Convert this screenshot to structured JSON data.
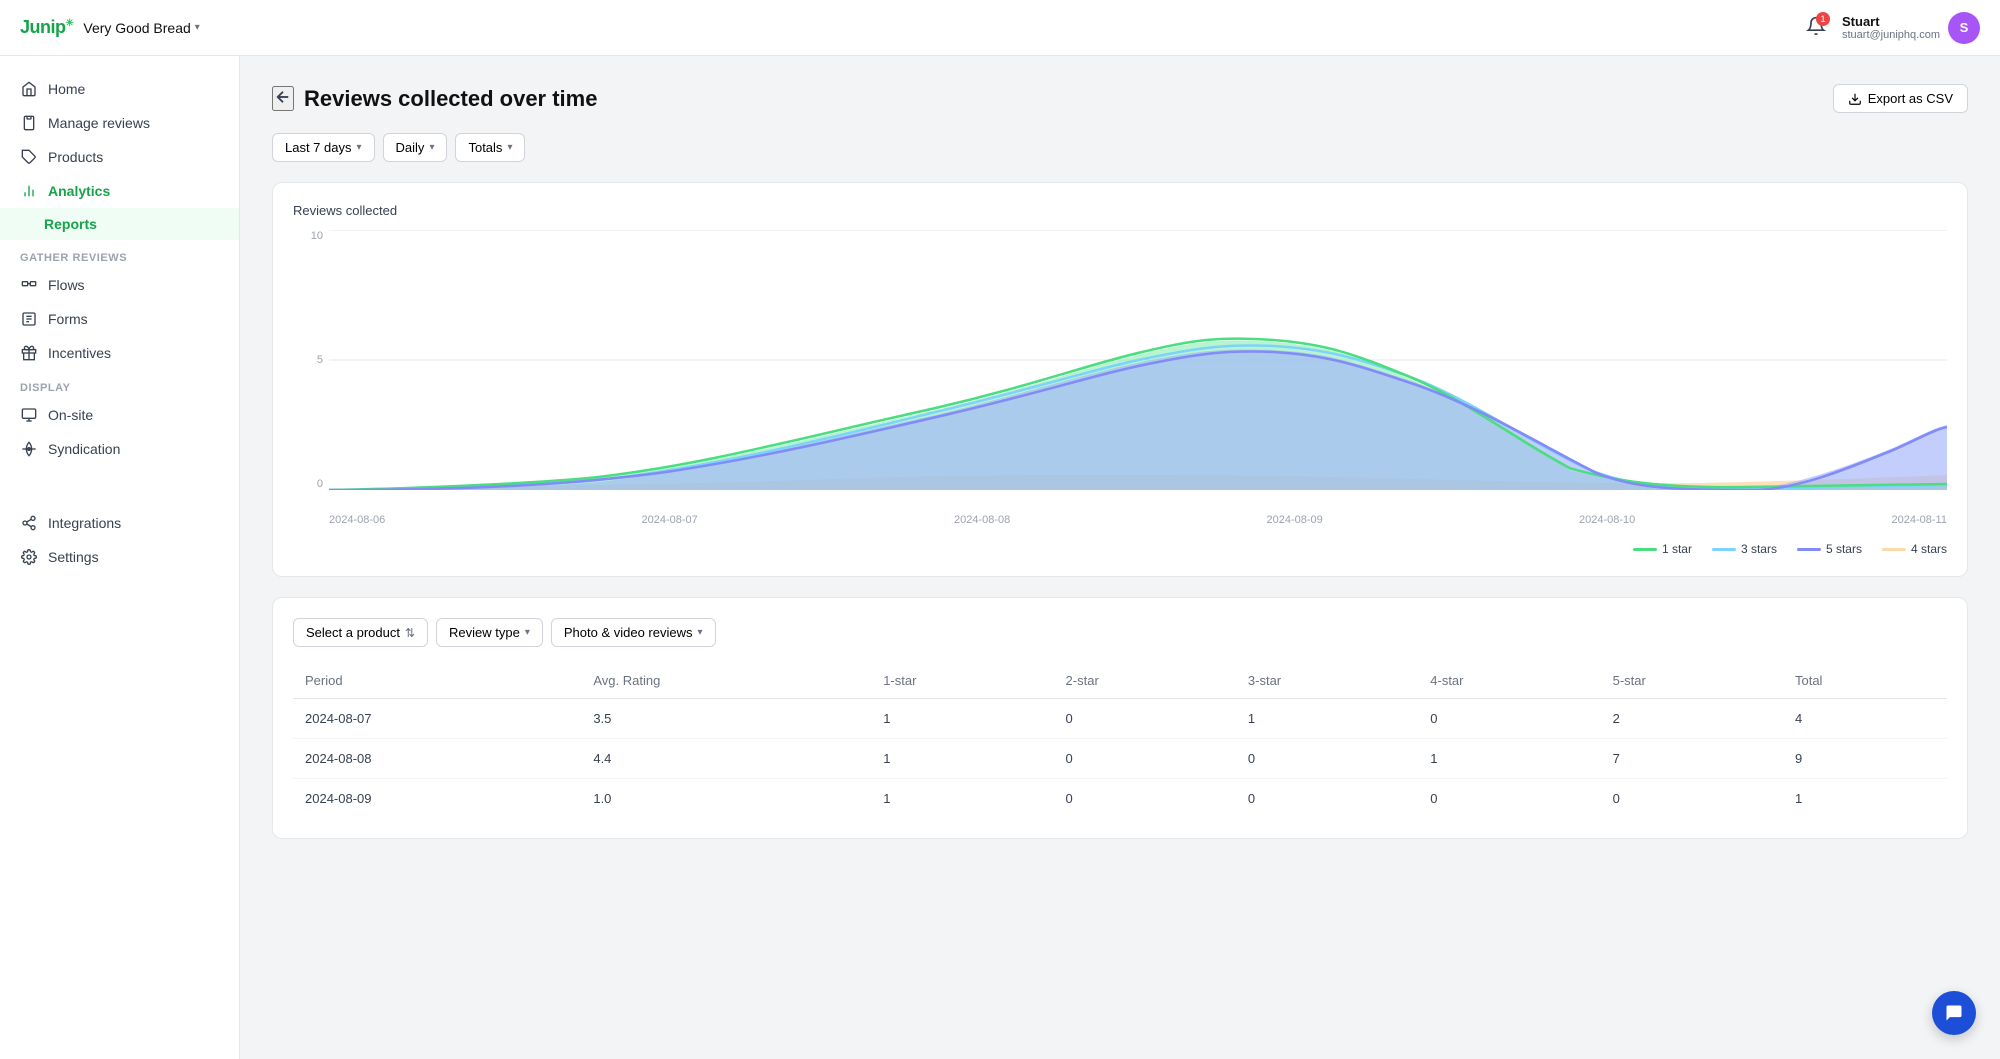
{
  "app": {
    "logo": "Junip",
    "brand": "Very Good Bread",
    "brand_dropdown_icon": "chevron-down"
  },
  "topnav": {
    "notification_count": "1",
    "user_name": "Stuart",
    "user_email": "stuart@juniphq.com",
    "user_initial": "S"
  },
  "sidebar": {
    "main_items": [
      {
        "id": "home",
        "label": "Home",
        "icon": "home"
      },
      {
        "id": "manage-reviews",
        "label": "Manage reviews",
        "icon": "clipboard"
      },
      {
        "id": "products",
        "label": "Products",
        "icon": "tag"
      },
      {
        "id": "analytics",
        "label": "Analytics",
        "icon": "bar-chart",
        "active": false
      },
      {
        "id": "reports",
        "label": "Reports",
        "icon": "sub",
        "active": true
      }
    ],
    "gather_section": "Gather reviews",
    "gather_items": [
      {
        "id": "flows",
        "label": "Flows",
        "icon": "flow"
      },
      {
        "id": "forms",
        "label": "Forms",
        "icon": "form"
      },
      {
        "id": "incentives",
        "label": "Incentives",
        "icon": "gift"
      }
    ],
    "display_section": "Display",
    "display_items": [
      {
        "id": "on-site",
        "label": "On-site",
        "icon": "monitor"
      },
      {
        "id": "syndication",
        "label": "Syndication",
        "icon": "syndication"
      }
    ],
    "bottom_items": [
      {
        "id": "integrations",
        "label": "Integrations",
        "icon": "integrations"
      },
      {
        "id": "settings",
        "label": "Settings",
        "icon": "settings"
      }
    ]
  },
  "page": {
    "back_label": "←",
    "title": "Reviews collected over time",
    "export_label": "Export as CSV"
  },
  "filters": [
    {
      "id": "date-range",
      "label": "Last 7 days"
    },
    {
      "id": "frequency",
      "label": "Daily"
    },
    {
      "id": "totals",
      "label": "Totals"
    }
  ],
  "chart": {
    "title": "Reviews collected",
    "y_labels": [
      "10",
      "5",
      "0"
    ],
    "x_labels": [
      "2024-08-06",
      "2024-08-07",
      "2024-08-08",
      "2024-08-09",
      "2024-08-10",
      "2024-08-11"
    ],
    "legend": [
      {
        "id": "1star",
        "label": "1 star",
        "color": "#4ade80"
      },
      {
        "id": "3stars",
        "label": "3 stars",
        "color": "#7dd3fc"
      },
      {
        "id": "5stars",
        "label": "5 stars",
        "color": "#818cf8"
      },
      {
        "id": "4stars",
        "label": "4 stars",
        "color": "#fcd9a8"
      }
    ]
  },
  "table_filters": [
    {
      "id": "product",
      "label": "Select a product",
      "type": "selector"
    },
    {
      "id": "review-type",
      "label": "Review type"
    },
    {
      "id": "media-type",
      "label": "Photo & video reviews"
    }
  ],
  "table": {
    "headers": [
      "Period",
      "Avg. Rating",
      "1-star",
      "2-star",
      "3-star",
      "4-star",
      "5-star",
      "Total"
    ],
    "rows": [
      {
        "period": "2024-08-07",
        "avg_rating": "3.5",
        "one_star": "1",
        "two_star": "0",
        "three_star": "1",
        "four_star": "0",
        "five_star": "2",
        "total": "4"
      },
      {
        "period": "2024-08-08",
        "avg_rating": "4.4",
        "one_star": "1",
        "two_star": "0",
        "three_star": "0",
        "four_star": "1",
        "five_star": "7",
        "total": "9"
      },
      {
        "period": "2024-08-09",
        "avg_rating": "1.0",
        "one_star": "1",
        "two_star": "0",
        "three_star": "0",
        "four_star": "0",
        "five_star": "0",
        "total": "1"
      }
    ]
  },
  "chat_icon": "💬"
}
